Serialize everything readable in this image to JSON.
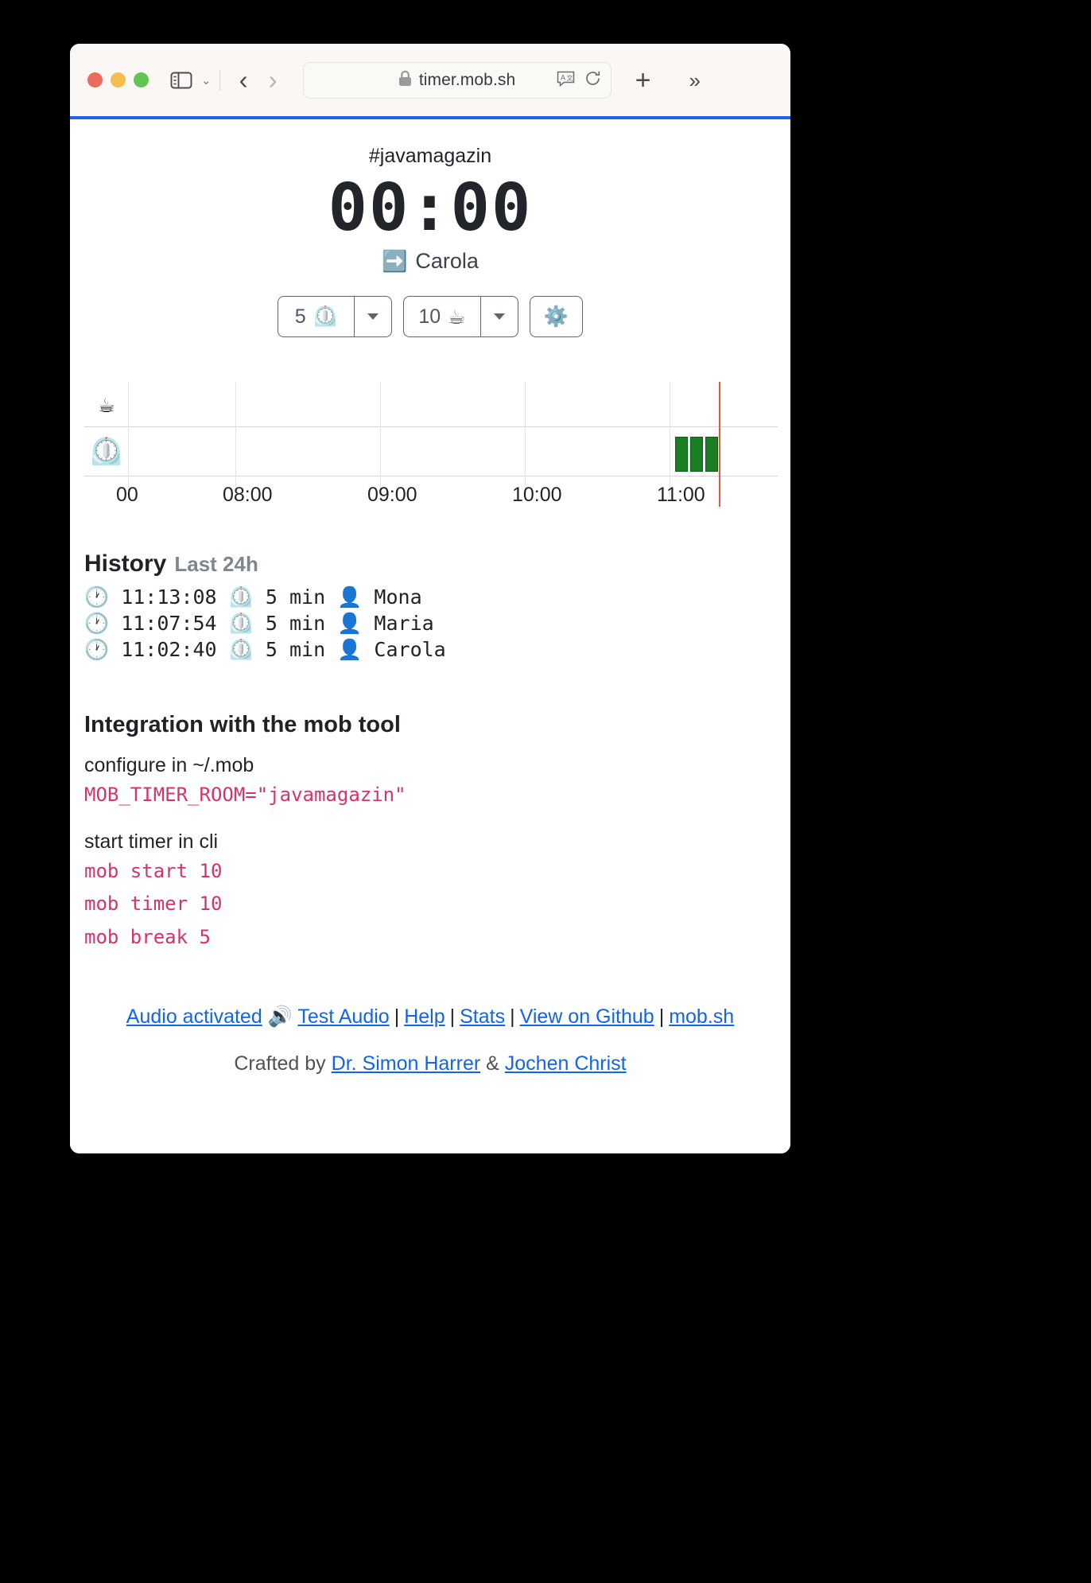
{
  "browser": {
    "url": "timer.mob.sh",
    "lock_icon": "🔒",
    "sidebar_icon": "sidebar-icon",
    "back_icon": "‹",
    "forward_icon": "›",
    "chevron_down_icon": "⌄",
    "translate_icon": "translate-icon",
    "reload_icon": "↻",
    "new_tab_icon": "+",
    "more_icon": "»"
  },
  "app": {
    "room": "#javamagazin",
    "timer": "00:00",
    "current_user": "Carola",
    "current_user_icon": "➡️"
  },
  "controls": {
    "timer_value": "5",
    "timer_icon": "⏲️",
    "timer_caret": "caret-down",
    "break_value": "10",
    "break_icon": "☕",
    "break_caret": "caret-down",
    "settings_icon": "⚙️"
  },
  "chart_data": {
    "type": "bar",
    "title": "",
    "rows": [
      {
        "label": "☕",
        "name": "break-row",
        "bars": []
      },
      {
        "label": "⏲️",
        "name": "timer-row",
        "bars": [
          {
            "start": "11:02:40",
            "duration_min": 5
          },
          {
            "start": "11:07:54",
            "duration_min": 5
          },
          {
            "start": "11:13:08",
            "duration_min": 5
          }
        ]
      }
    ],
    "xticks": [
      "00",
      "08:00",
      "09:00",
      "10:00",
      "11:00"
    ],
    "now_marker": "11:18",
    "bar_color": "#1a7e23",
    "now_color": "#f4503c",
    "grid": true
  },
  "history": {
    "title": "History",
    "subtitle": "Last 24h",
    "clock_icon": "🕐",
    "timer_icon": "⏲️",
    "user_icon": "👤",
    "entries": [
      {
        "time": "11:13:08",
        "duration": "5 min",
        "user": "Mona"
      },
      {
        "time": "11:07:54",
        "duration": "5 min",
        "user": "Maria"
      },
      {
        "time": "11:02:40",
        "duration": "5 min",
        "user": "Carola"
      }
    ]
  },
  "integration": {
    "title": "Integration with the mob tool",
    "configure_label": "configure in ~/.mob",
    "configure_code": "MOB_TIMER_ROOM=\"javamagazin\"",
    "start_label": "start timer in cli",
    "commands": [
      "mob start 10",
      "mob timer 10",
      "mob break 5"
    ]
  },
  "footer": {
    "audio_label": "Audio activated",
    "audio_icon": "🔊",
    "test_audio": "Test Audio",
    "help": "Help",
    "stats": "Stats",
    "github": "View on Github",
    "mobsh": "mob.sh",
    "separator": "|",
    "crafted_prefix": "Crafted by",
    "author1": "Dr. Simon Harrer",
    "amp": "&",
    "author2": "Jochen Christ"
  }
}
